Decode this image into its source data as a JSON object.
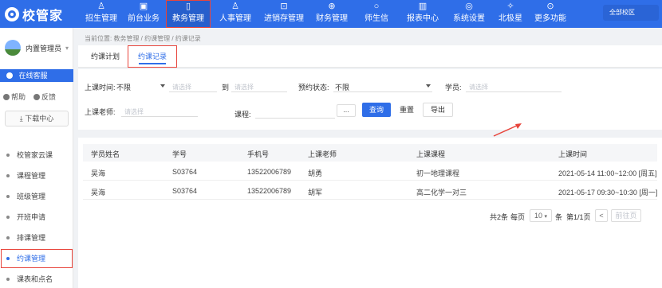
{
  "app": {
    "logo_text": "校管家",
    "campus": "全部校区"
  },
  "nav": [
    {
      "label": "招生管理",
      "icon": "person-icon",
      "glyph": "♙"
    },
    {
      "label": "前台业务",
      "icon": "clipboard-icon",
      "glyph": "▣"
    },
    {
      "label": "教务管理",
      "icon": "book-icon",
      "glyph": "▯"
    },
    {
      "label": "人事管理",
      "icon": "people-icon",
      "glyph": "♙"
    },
    {
      "label": "进销存管理",
      "icon": "inventory-icon",
      "glyph": "⊡"
    },
    {
      "label": "财务管理",
      "icon": "wallet-icon",
      "glyph": "⊕"
    },
    {
      "label": "师生信",
      "icon": "message-icon",
      "glyph": "○"
    },
    {
      "label": "报表中心",
      "icon": "report-icon",
      "glyph": "▥"
    },
    {
      "label": "系统设置",
      "icon": "settings-icon",
      "glyph": "◎"
    },
    {
      "label": "北极星",
      "icon": "star-icon",
      "glyph": "✧"
    },
    {
      "label": "更多功能",
      "icon": "more-icon",
      "glyph": "⊙"
    }
  ],
  "nav_active_index": 2,
  "sidebar": {
    "user_name": "内置管理员",
    "online_service": "在线客服",
    "help": "帮助",
    "feedback": "反馈",
    "download": "下载中心",
    "menu": [
      {
        "label": "校管家云课"
      },
      {
        "label": "课程管理"
      },
      {
        "label": "班级管理"
      },
      {
        "label": "开班申请"
      },
      {
        "label": "排课管理"
      },
      {
        "label": "约课管理"
      },
      {
        "label": "课表和点名"
      }
    ],
    "active_index": 5
  },
  "breadcrumb": "当前位置: 教务管理 / 约课管理 / 约课记录",
  "tabs": [
    {
      "label": "约课计划"
    },
    {
      "label": "约课记录"
    }
  ],
  "active_tab": 1,
  "filters": {
    "time_label": "上课时间:",
    "time_value": "不限",
    "start_placeholder": "请选择",
    "to_label": "到",
    "end_placeholder": "请选择",
    "status_label": "预约状态:",
    "status_value": "不限",
    "student_label": "学员:",
    "student_placeholder": "请选择",
    "teacher_label": "上课老师:",
    "teacher_placeholder": "请选择",
    "course_label": "课程:",
    "course_ellipsis": "...",
    "search_button": "查询",
    "reset_button": "重置",
    "export_button": "导出"
  },
  "table": {
    "headers": [
      "学员姓名",
      "学号",
      "手机号",
      "上课老师",
      "上课课程",
      "上课时间"
    ],
    "rows": [
      [
        "吴海",
        "S03764",
        "13522006789",
        "胡勇",
        "初一地理课程",
        "2021-05-14 11:00~12:00 [周五]"
      ],
      [
        "吴海",
        "S03764",
        "13522006789",
        "胡军",
        "高二化学一对三",
        "2021-05-17 09:30~10:30 [周一]"
      ]
    ]
  },
  "pager": {
    "total_text": "共2条",
    "per_page_label": "每页",
    "per_page_value": "10",
    "per_page_unit": "条",
    "page_text": "第1/1页",
    "prev_glyph": "<",
    "prev_label": "前往页"
  },
  "colors": {
    "primary": "#2f6ee8",
    "highlight": "#e8453c"
  }
}
